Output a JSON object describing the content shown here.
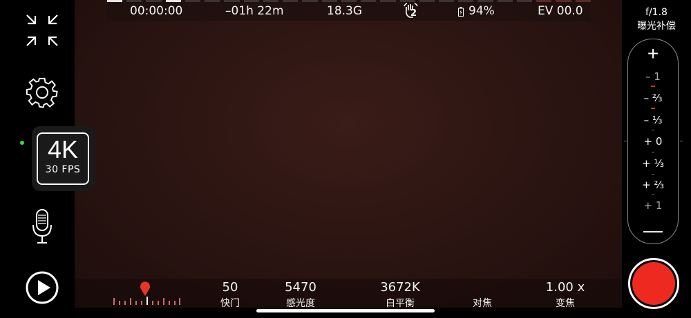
{
  "status": {
    "timecode": "00:00:00",
    "remaining": "–01h 22m",
    "storage": "18.3G",
    "stabilizer_level": "2",
    "battery": "94%",
    "ev": "EV 00.0"
  },
  "resolution": {
    "main": "4K",
    "fps": "30 FPS"
  },
  "exposure": {
    "aperture": "f/1.8",
    "label": "曝光补偿",
    "plus": "+",
    "minus": "—",
    "scale": [
      "– 1",
      "– ⅔",
      "– ⅓",
      "+ 0",
      "+ ⅓",
      "+ ⅔",
      "+ 1"
    ]
  },
  "params": [
    {
      "value": "50",
      "label": "快门"
    },
    {
      "value": "5470",
      "label": "感光度"
    },
    {
      "value": "3672K",
      "label": "白平衡"
    },
    {
      "value": "",
      "label": "对焦"
    },
    {
      "value": "1.00 x",
      "label": "变焦"
    }
  ],
  "icons": {
    "collapse": "collapse-arrows-icon",
    "settings": "gear-icon",
    "microphone": "microphone-icon",
    "playback": "play-icon",
    "stabilizer": "stabilizer-hand-icon",
    "battery": "battery-icon",
    "location": "location-pin-icon"
  },
  "colors": {
    "record": "#ee2a20",
    "accent_green": "#3fd25a",
    "viewfinder": "#2a1411"
  }
}
